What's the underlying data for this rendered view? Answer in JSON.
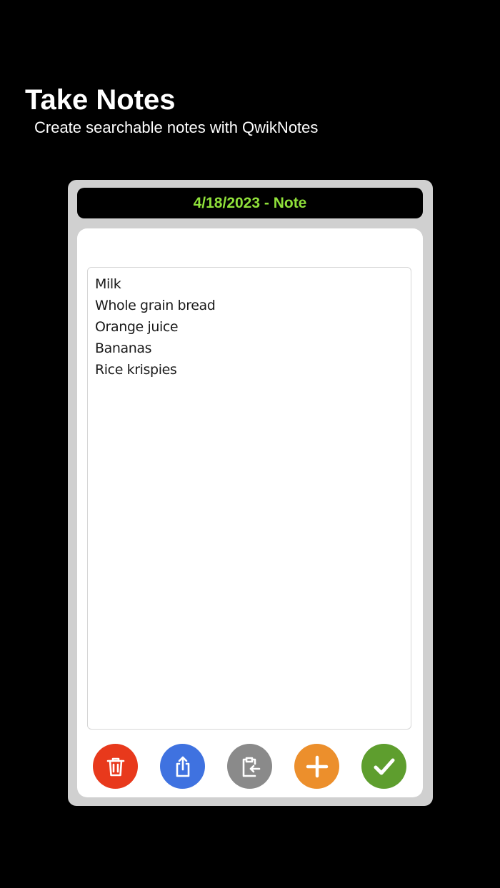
{
  "promo": {
    "title": "Take Notes",
    "subtitle": "Create searchable notes with QwikNotes"
  },
  "note": {
    "header_title": "4/18/2023 - Note",
    "lines": [
      "Milk",
      "Whole grain bread",
      "Orange juice",
      "Bananas",
      "Rice krispies"
    ]
  },
  "actions": [
    {
      "name": "delete",
      "icon": "trash-icon",
      "color": "#e8391c"
    },
    {
      "name": "share",
      "icon": "share-icon",
      "color": "#3f72e0"
    },
    {
      "name": "paste",
      "icon": "clipboard-paste-icon",
      "color": "#8a8a8a"
    },
    {
      "name": "add",
      "icon": "plus-icon",
      "color": "#ec8f2c"
    },
    {
      "name": "save",
      "icon": "checkmark-icon",
      "color": "#5e9e2e"
    }
  ],
  "colors": {
    "background": "#000000",
    "frame": "#d0d0d0",
    "header_text": "#8fe03a"
  }
}
